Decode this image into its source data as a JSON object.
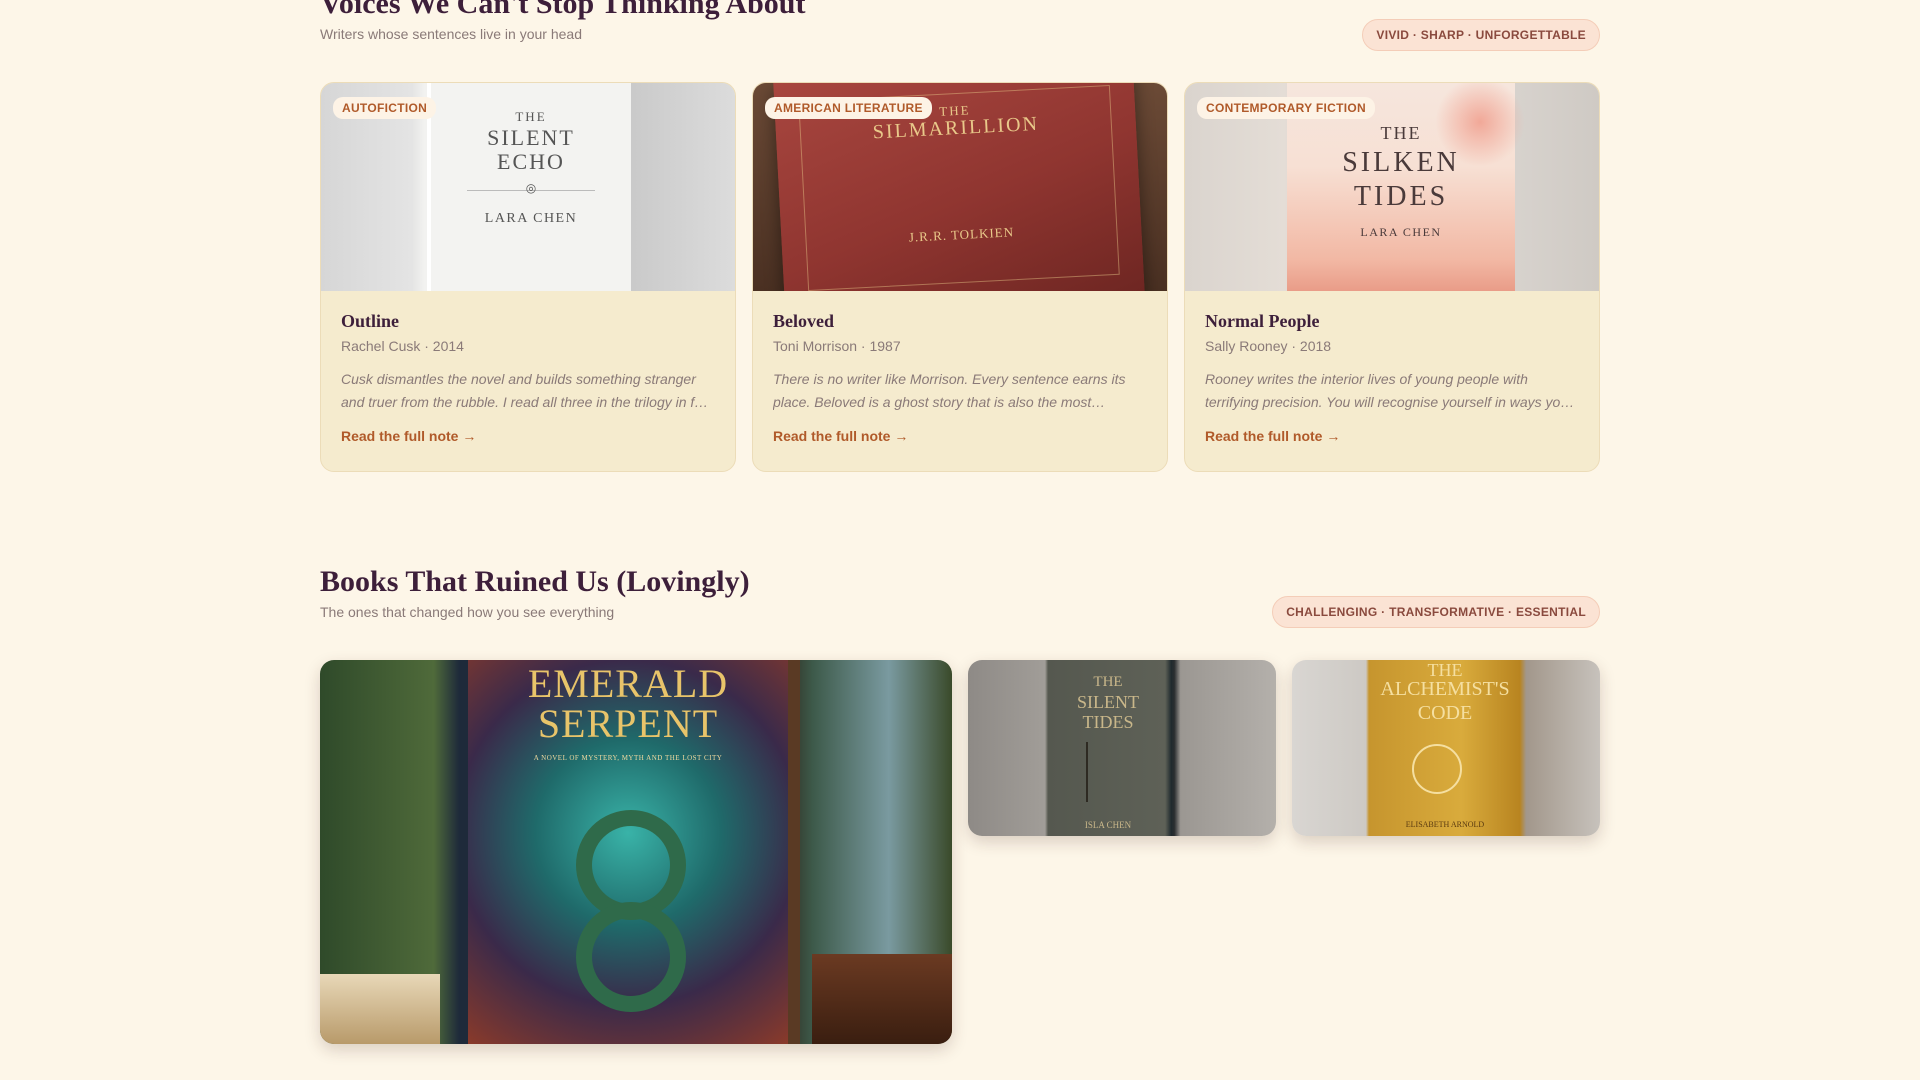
{
  "section1": {
    "title": "Voices We Can't Stop Thinking About",
    "subtitle": "Writers whose sentences live in your head",
    "pill": "VIVID · SHARP · UNFORGETTABLE",
    "cards": [
      {
        "tag": "AUTOFICTION",
        "title": "Outline",
        "meta": "Rachel Cusk · 2014",
        "note": "Cusk dismantles the novel and builds something stranger and truer from the rubble. I read all three in the trilogy in f…",
        "link": "Read the full note →",
        "cover": {
          "line1": "THE",
          "line2": "SILENT",
          "line3": "ECHO",
          "author": "LARA CHEN",
          "ornament": "◎"
        }
      },
      {
        "tag": "AMERICAN LITERATURE",
        "title": "Beloved",
        "meta": "Toni Morrison · 1987",
        "note": "There is no writer like Morrison. Every sentence earns its place. Beloved is a ghost story that is also the most…",
        "link": "Read the full note →",
        "cover": {
          "line1": "THE",
          "line2": "SILMARILLION",
          "author": "J.R.R. TOLKIEN"
        }
      },
      {
        "tag": "CONTEMPORARY FICTION",
        "title": "Normal People",
        "meta": "Sally Rooney · 2018",
        "note": "Rooney writes the interior lives of young people with terrifying precision. You will recognise yourself in ways yo…",
        "link": "Read the full note →",
        "cover": {
          "line1": "THE",
          "line2": "SILKEN",
          "line3": "TIDES",
          "author": "LARA CHEN"
        }
      }
    ]
  },
  "section2": {
    "title": "Books That Ruined Us (Lovingly)",
    "subtitle": "The ones that changed how you see everything",
    "pill": "CHALLENGING · TRANSFORMATIVE · ESSENTIAL",
    "tiles": [
      {
        "line1": "EMERALD",
        "line2": "SERPENT",
        "tagline": "A NOVEL OF MYSTERY, MYTH AND THE LOST CITY"
      },
      {
        "line1": "THE",
        "line2": "SILENT",
        "line3": "TIDES",
        "author": "ISLA CHEN"
      },
      {
        "line1": "THE",
        "line2": "ALCHEMIST'S",
        "line3": "CODE",
        "author": "ELISABETH ARNOLD"
      }
    ]
  }
}
